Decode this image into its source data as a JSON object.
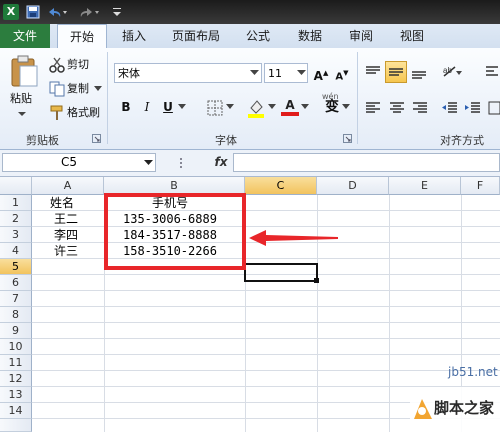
{
  "window": {
    "logo": "X",
    "qat": [
      "save-icon",
      "undo-icon",
      "redo-icon",
      "customize-icon"
    ]
  },
  "tabs": [
    "文件",
    "开始",
    "插入",
    "页面布局",
    "公式",
    "数据",
    "审阅",
    "视图"
  ],
  "ribbon": {
    "clipboard": {
      "paste": "粘贴",
      "cut": "剪切",
      "copy": "复制",
      "format_painter": "格式刷",
      "group": "剪贴板"
    },
    "font": {
      "name": "宋体",
      "size": "11",
      "bold": "B",
      "italic": "I",
      "underline": "U",
      "wen": "wén",
      "group": "字体"
    },
    "alignment": {
      "group": "对齐方式"
    }
  },
  "formula_bar": {
    "name_box": "C5",
    "fx": "fx",
    "value": ""
  },
  "columns": [
    "A",
    "B",
    "C",
    "D",
    "E",
    "F"
  ],
  "rows": [
    "1",
    "2",
    "3",
    "4",
    "5",
    "6",
    "7",
    "8",
    "9",
    "10",
    "11",
    "12",
    "13",
    "14"
  ],
  "cells": {
    "A1": "姓名",
    "B1": "手机号",
    "A2": "王二",
    "B2": "135-3006-6889",
    "A3": "李四",
    "B3": "184-3517-8888",
    "A4": "许三",
    "B4": "158-3510-2266"
  },
  "watermark": {
    "site": "jb51.net",
    "brand": "脚本之家"
  },
  "colors": {
    "highlight_box": "#e8262a",
    "file_tab": "#2c7d3e",
    "selected_header": "#f2c35e"
  }
}
